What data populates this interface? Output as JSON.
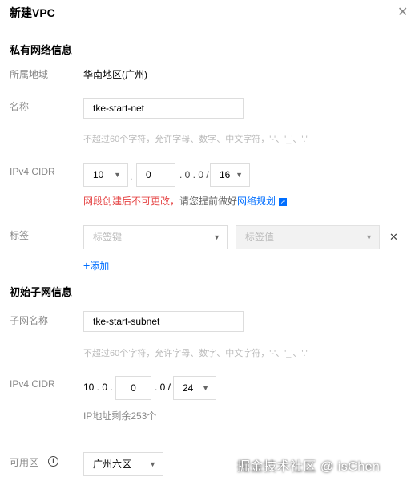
{
  "dialog": {
    "title": "新建VPC",
    "close_label": "✕"
  },
  "vpc_section": {
    "heading": "私有网络信息",
    "region": {
      "label": "所属地域",
      "value": "华南地区(广州)"
    },
    "name": {
      "label": "名称",
      "value": "tke-start-net",
      "hint": "不超过60个字符，允许字母、数字、中文字符，'-'、'_'、'.'"
    },
    "cidr": {
      "label": "IPv4 CIDR",
      "octet1": "10",
      "octet2": "0",
      "fixed_octets": ". 0 . 0 /",
      "sep": ".",
      "mask": "16",
      "warning": "网段创建后不可更改，",
      "advice": "请您提前做好",
      "link": "网络规划"
    },
    "tags": {
      "label": "标签",
      "key_placeholder": "标签键",
      "value_placeholder": "标签值",
      "remove_label": "✕",
      "add_label": "添加"
    }
  },
  "subnet_section": {
    "heading": "初始子网信息",
    "name": {
      "label": "子网名称",
      "value": "tke-start-subnet",
      "hint": "不超过60个字符，允许字母、数字、中文字符，'-'、'_'、'.'"
    },
    "cidr": {
      "label": "IPv4 CIDR",
      "prefix": "10 . 0 .",
      "octet3": "0",
      "suffix": ". 0 /",
      "mask": "24",
      "remaining": "IP地址剩余253个"
    },
    "zone": {
      "label": "可用区",
      "value": "广州六区"
    }
  },
  "watermark": "掘金技术社区 @ isChen",
  "icons": {
    "close": "close-icon",
    "dropdown": "chevron-down-icon",
    "external": "external-link-icon",
    "add": "plus-icon",
    "info": "info-icon"
  },
  "colors": {
    "link": "#006eff",
    "warning": "#e54545"
  }
}
